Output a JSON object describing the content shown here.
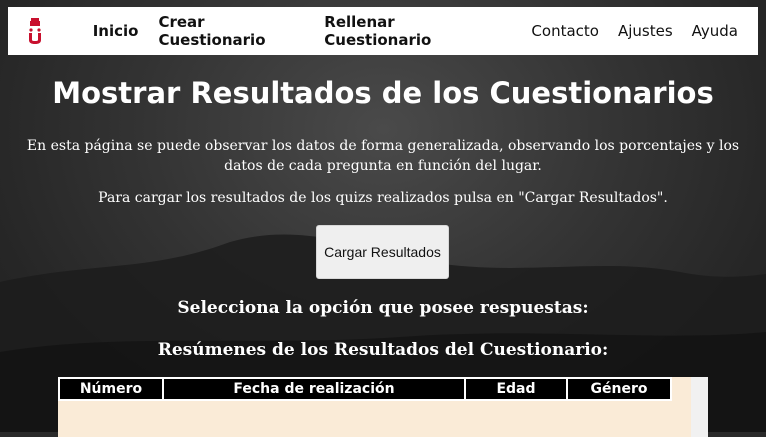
{
  "navbar": {
    "logo_icon": "university-crest-icon",
    "left_links": [
      "Inicio",
      "Crear Cuestionario",
      "Rellenar Cuestionario"
    ],
    "right_links": [
      "Contacto",
      "Ajustes",
      "Ayuda"
    ]
  },
  "main": {
    "title": "Mostrar Resultados de los Cuestionarios",
    "description": "En esta página se puede observar los datos de forma generalizada, observando los porcentajes y los datos de cada pregunta en función del lugar.",
    "instruction": "Para cargar los resultados de los quizs realizados pulsa en \"Cargar Resultados\".",
    "load_button": "Cargar Resultados",
    "select_title": "Selecciona la opción que posee respuestas:",
    "summary_title": "Resúmenes de los Resultados del Cuestionario:"
  },
  "table": {
    "headers": [
      "Número",
      "Fecha de realización",
      "Edad",
      "Género"
    ]
  },
  "colors": {
    "accent": "#c8102e",
    "table_bg": "#faebd7",
    "header_bg": "#000000"
  }
}
